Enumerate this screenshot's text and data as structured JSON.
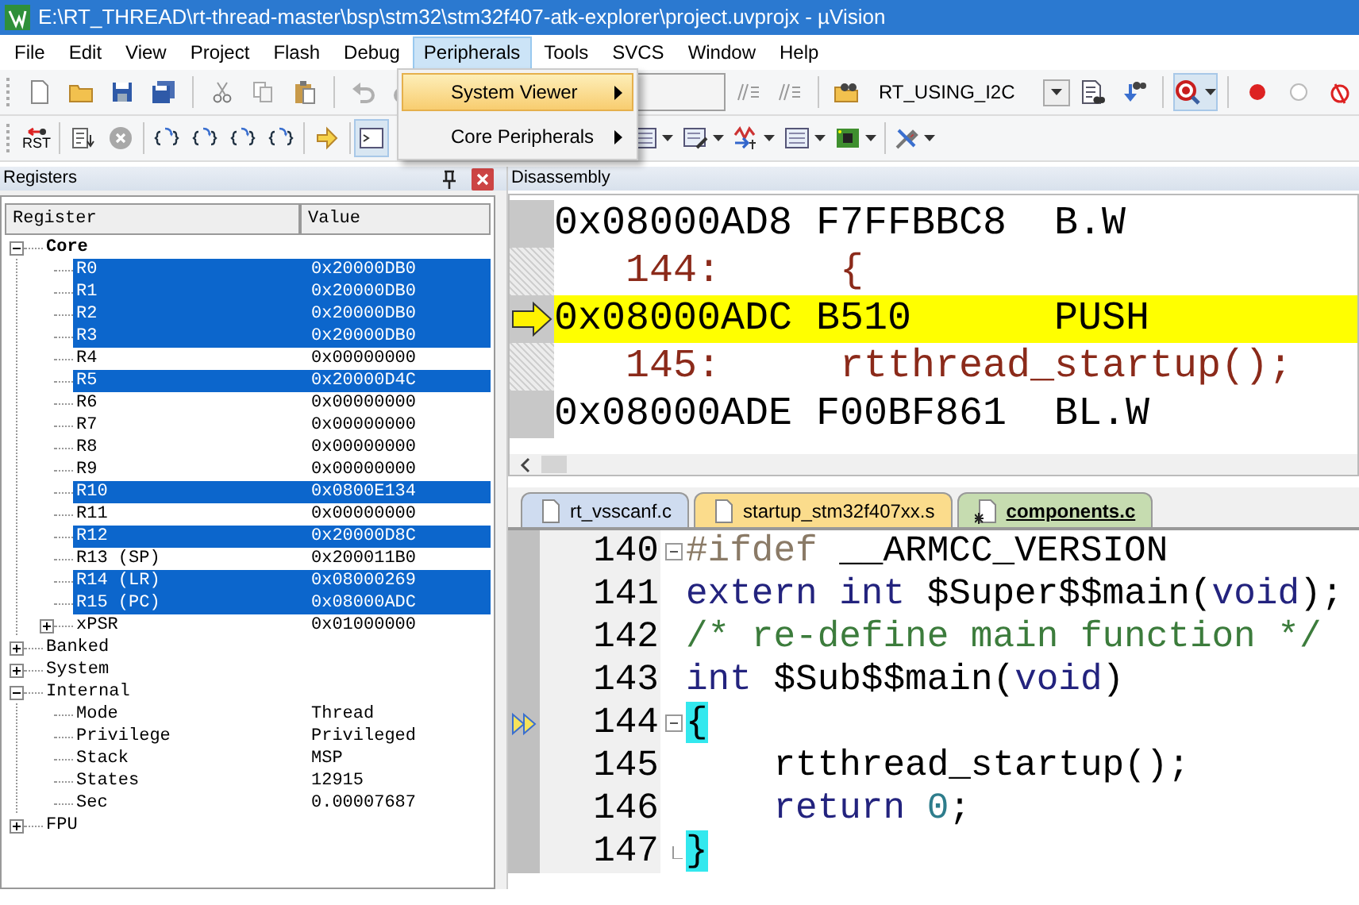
{
  "window": {
    "title": "E:\\RT_THREAD\\rt-thread-master\\bsp\\stm32\\stm32f407-atk-explorer\\project.uvprojx - µVision"
  },
  "menu": [
    {
      "label": "File",
      "selected": false
    },
    {
      "label": "Edit",
      "selected": false
    },
    {
      "label": "View",
      "selected": false
    },
    {
      "label": "Project",
      "selected": false
    },
    {
      "label": "Flash",
      "selected": false
    },
    {
      "label": "Debug",
      "selected": false
    },
    {
      "label": "Peripherals",
      "selected": true
    },
    {
      "label": "Tools",
      "selected": false
    },
    {
      "label": "SVCS",
      "selected": false
    },
    {
      "label": "Window",
      "selected": false
    },
    {
      "label": "Help",
      "selected": false
    }
  ],
  "peripherals_menu": [
    {
      "label": "System Viewer",
      "selected": true,
      "submenu": true
    },
    {
      "label": "Core Peripherals",
      "selected": false,
      "submenu": true
    }
  ],
  "toolbar": {
    "config_combo": "RT_USING_I2C",
    "reset_label": "RST"
  },
  "registers_panel": {
    "title": "Registers",
    "columns": [
      "Register",
      "Value"
    ],
    "rows": [
      {
        "name": "Core",
        "bold": true,
        "expanded": true,
        "selected": false,
        "children": [
          {
            "name": "R0",
            "value": "0x20000DB0",
            "selected": true
          },
          {
            "name": "R1",
            "value": "0x20000DB0",
            "selected": true
          },
          {
            "name": "R2",
            "value": "0x20000DB0",
            "selected": true
          },
          {
            "name": "R3",
            "value": "0x20000DB0",
            "selected": true
          },
          {
            "name": "R4",
            "value": "0x00000000",
            "selected": false
          },
          {
            "name": "R5",
            "value": "0x20000D4C",
            "selected": true
          },
          {
            "name": "R6",
            "value": "0x00000000",
            "selected": false
          },
          {
            "name": "R7",
            "value": "0x00000000",
            "selected": false
          },
          {
            "name": "R8",
            "value": "0x00000000",
            "selected": false
          },
          {
            "name": "R9",
            "value": "0x00000000",
            "selected": false
          },
          {
            "name": "R10",
            "value": "0x0800E134",
            "selected": true
          },
          {
            "name": "R11",
            "value": "0x00000000",
            "selected": false
          },
          {
            "name": "R12",
            "value": "0x20000D8C",
            "selected": true
          },
          {
            "name": "R13 (SP)",
            "value": "0x200011B0",
            "selected": false
          },
          {
            "name": "R14 (LR)",
            "value": "0x08000269",
            "selected": true
          },
          {
            "name": "R15 (PC)",
            "value": "0x08000ADC",
            "selected": true
          },
          {
            "name": "xPSR",
            "value": "0x01000000",
            "selected": false,
            "expanded": false
          }
        ]
      },
      {
        "name": "Banked",
        "bold": false,
        "expanded": false,
        "selected": false
      },
      {
        "name": "System",
        "bold": false,
        "expanded": false,
        "selected": false
      },
      {
        "name": "Internal",
        "bold": false,
        "expanded": true,
        "selected": false,
        "children": [
          {
            "name": "Mode",
            "value": "Thread",
            "selected": false
          },
          {
            "name": "Privilege",
            "value": "Privileged",
            "selected": false
          },
          {
            "name": "Stack",
            "value": "MSP",
            "selected": false
          },
          {
            "name": "States",
            "value": "12915",
            "selected": false
          },
          {
            "name": "Sec",
            "value": "0.00007687",
            "selected": false
          }
        ]
      },
      {
        "name": "FPU",
        "bold": false,
        "expanded": false,
        "selected": false
      }
    ]
  },
  "disassembly": {
    "title": "Disassembly",
    "lines": [
      {
        "kind": "asm",
        "address": "0x08000AD8",
        "opcode": "F7FFBBC8",
        "mnemonic": "B.W",
        "current": false
      },
      {
        "kind": "source",
        "line": "144:",
        "code": "{"
      },
      {
        "kind": "asm",
        "address": "0x08000ADC",
        "opcode": "B510",
        "mnemonic": "PUSH",
        "current": true
      },
      {
        "kind": "source",
        "line": "145:",
        "code": "rtthread_startup();"
      },
      {
        "kind": "asm",
        "address": "0x08000ADE",
        "opcode": "F00BF861",
        "mnemonic": "BL.W",
        "current": false
      }
    ]
  },
  "editor": {
    "tabs": [
      {
        "label": "rt_vsscanf.c",
        "color": "#cfdcf0",
        "selected": false,
        "modified": false
      },
      {
        "label": "startup_stm32f407xx.s",
        "color": "#fbdc8c",
        "selected": false,
        "modified": false
      },
      {
        "label": "components.c",
        "color": "#c6dcb0",
        "selected": true,
        "modified": true
      }
    ],
    "lines": [
      {
        "number": "140",
        "fold_start": true,
        "fold_end": false,
        "marker": false,
        "tokens": [
          {
            "kind": "preprocessor",
            "text": "#ifdef"
          },
          {
            "kind": "plain",
            "text": " __ARMCC_VERSION"
          }
        ]
      },
      {
        "number": "141",
        "fold_start": false,
        "fold_end": false,
        "marker": false,
        "tokens": [
          {
            "kind": "keyword",
            "text": "extern"
          },
          {
            "kind": "keyword",
            "text": " int"
          },
          {
            "kind": "plain",
            "text": " $Super$$main("
          },
          {
            "kind": "keyword",
            "text": "void"
          },
          {
            "kind": "plain",
            "text": ");"
          }
        ]
      },
      {
        "number": "142",
        "fold_start": false,
        "fold_end": false,
        "marker": false,
        "tokens": [
          {
            "kind": "comment",
            "text": "/* re-define main function */"
          }
        ]
      },
      {
        "number": "143",
        "fold_start": false,
        "fold_end": false,
        "marker": false,
        "tokens": [
          {
            "kind": "keyword",
            "text": "int"
          },
          {
            "kind": "plain",
            "text": " $Sub$$main("
          },
          {
            "kind": "keyword",
            "text": "void"
          },
          {
            "kind": "plain",
            "text": ")"
          }
        ]
      },
      {
        "number": "144",
        "fold_start": true,
        "fold_end": false,
        "marker": true,
        "tokens": [
          {
            "kind": "brace-match",
            "text": "{"
          }
        ]
      },
      {
        "number": "145",
        "fold_start": false,
        "fold_end": false,
        "marker": false,
        "tokens": [
          {
            "kind": "plain",
            "text": "    rtthread_startup();"
          }
        ]
      },
      {
        "number": "146",
        "fold_start": false,
        "fold_end": false,
        "marker": false,
        "tokens": [
          {
            "kind": "keyword",
            "text": "    return"
          },
          {
            "kind": "number",
            "text": " 0"
          },
          {
            "kind": "plain",
            "text": ";"
          }
        ]
      },
      {
        "number": "147",
        "fold_start": false,
        "fold_end": true,
        "marker": false,
        "tokens": [
          {
            "kind": "brace-match",
            "text": "}"
          }
        ]
      }
    ]
  }
}
